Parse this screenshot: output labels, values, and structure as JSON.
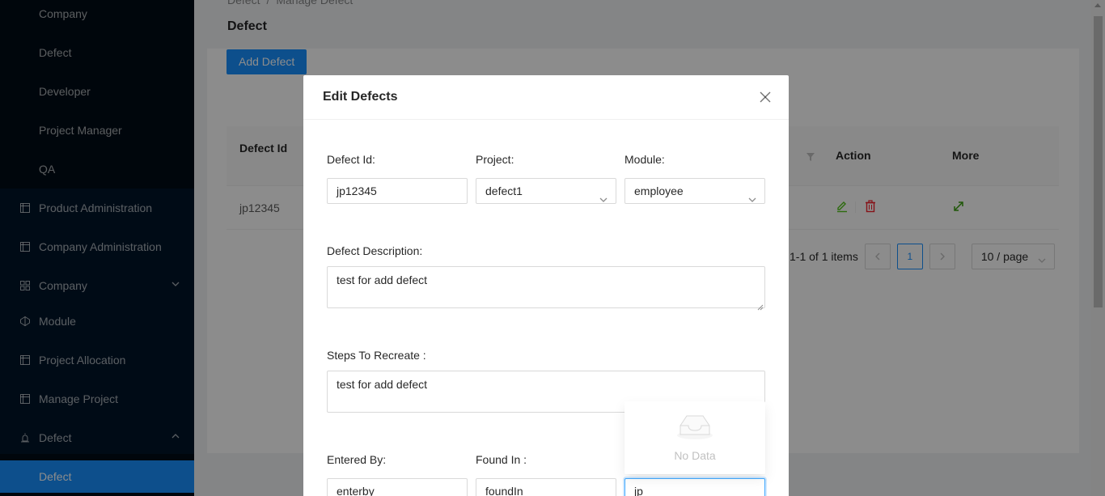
{
  "sidebar": {
    "sub_items_top": [
      "Company",
      "Defect",
      "Developer",
      "Project Manager",
      "QA"
    ],
    "items": [
      {
        "label": "Product Administration",
        "icon": "table-icon"
      },
      {
        "label": "Company Administration",
        "icon": "table-icon"
      },
      {
        "label": "Company",
        "icon": "appstore-icon"
      },
      {
        "label": "Module",
        "icon": "codepen-icon"
      },
      {
        "label": "Project Allocation",
        "icon": "table-icon"
      },
      {
        "label": "Manage Project",
        "icon": "table-icon"
      },
      {
        "label": "Defect",
        "icon": "alarm-icon"
      }
    ],
    "active_sub": "Defect"
  },
  "breadcrumb": {
    "root": "Defect",
    "sep": "/",
    "current": "Manage Defect"
  },
  "page": {
    "title": "Defect",
    "add_button": "Add Defect"
  },
  "table": {
    "headers": {
      "defect_id": "Defect Id",
      "action": "Action",
      "more": "More"
    },
    "rows": [
      {
        "defect_id": "jp12345"
      }
    ]
  },
  "pagination": {
    "range": "1-1 of 1 items",
    "current": "1",
    "page_size": "10 / page"
  },
  "modal": {
    "title": "Edit Defects",
    "labels": {
      "defect_id": "Defect Id:",
      "project": "Project:",
      "module": "Module:",
      "description": "Defect Description:",
      "steps": "Steps To Recreate :",
      "entered_by": "Entered By:",
      "found_in": "Found In :"
    },
    "values": {
      "defect_id": "jp12345",
      "project": "defect1",
      "module": "employee",
      "description": "test for add defect",
      "steps": "test for add defect",
      "entered_by": "enterby",
      "found_in": "foundIn",
      "search": "jp"
    },
    "dropdown_empty": "No Data"
  },
  "colors": {
    "primary": "#1890ff",
    "sidebar": "#001529",
    "edit": "#52c41a",
    "delete": "#f5222d"
  }
}
